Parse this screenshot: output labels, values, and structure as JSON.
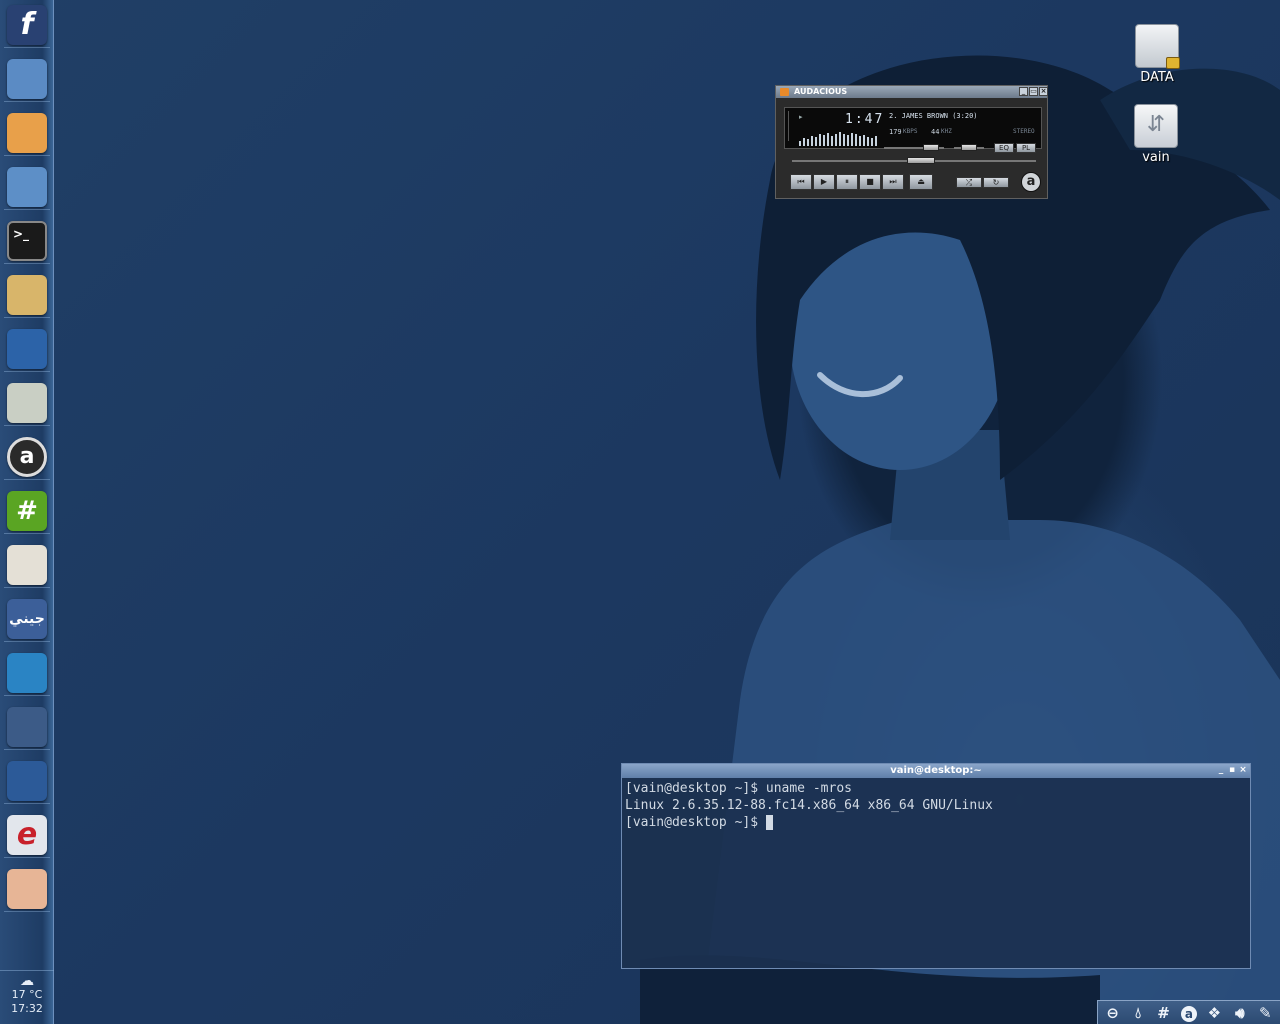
{
  "dock": {
    "items": [
      {
        "name": "fedora",
        "label": "f",
        "color": "#294172"
      },
      {
        "name": "chromium",
        "label": "",
        "color": "#5b8bc4"
      },
      {
        "name": "mail",
        "label": "",
        "color": "#e8a04a"
      },
      {
        "name": "home-folder",
        "label": "",
        "color": "#5d8fc7"
      },
      {
        "name": "terminal",
        "label": ">_",
        "color": "#1a1a1a"
      },
      {
        "name": "paint",
        "label": "",
        "color": "#d8b56a"
      },
      {
        "name": "openoffice",
        "label": "",
        "color": "#2c63a8"
      },
      {
        "name": "calculator",
        "label": "",
        "color": "#c9cfc4"
      },
      {
        "name": "audacious",
        "label": "a",
        "color": "#2a2a2a"
      },
      {
        "name": "irc-chat",
        "label": "#",
        "color": "#5aa523"
      },
      {
        "name": "text-editor",
        "label": "",
        "color": "#e4e0d6"
      },
      {
        "name": "arabic-app",
        "label": "جيني",
        "color": "#3c5f99"
      },
      {
        "name": "system-monitor",
        "label": "",
        "color": "#2a84c4"
      },
      {
        "name": "video-player",
        "label": "",
        "color": "#3c5b87"
      },
      {
        "name": "footprints",
        "label": "",
        "color": "#2c5a98"
      },
      {
        "name": "web-browser",
        "label": "e",
        "color": "#e2e6ec"
      },
      {
        "name": "eye-viewer",
        "label": "",
        "color": "#e7b596"
      }
    ],
    "weather": {
      "temp": "17 °C",
      "time": "17:32"
    }
  },
  "desktop_icons": [
    {
      "label": "DATA"
    },
    {
      "label": "vain"
    }
  ],
  "audacious": {
    "title": "AUDACIOUS",
    "time": "1:47",
    "track": "2. JAMES BROWN (3:20)",
    "kbps": "179",
    "kbps_unit": "KBPS",
    "khz": "44",
    "khz_unit": "KHZ",
    "mode": "STEREO",
    "eq_label": "EQ",
    "pl_label": "PL",
    "logo_letter": "a",
    "volume_level": 0.78,
    "balance_level": 0.5,
    "seek_level": 0.53
  },
  "terminal": {
    "title": "vain@desktop:~",
    "line1": "[vain@desktop ~]$ uname -mros",
    "line2": "Linux 2.6.35.12-88.fc14.x86_64 x86_64 GNU/Linux",
    "line3": "[vain@desktop ~]$ "
  },
  "tray": {
    "items": [
      "zoom-icon",
      "drop-icon",
      "hash-icon",
      "audacious-tray-icon",
      "dropbox-icon",
      "volume-icon",
      "pen-icon"
    ]
  }
}
